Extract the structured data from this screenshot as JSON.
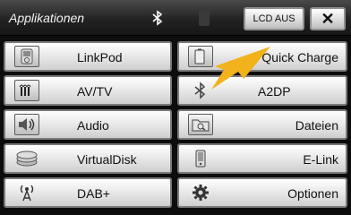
{
  "header": {
    "title": "Applikationen",
    "lcd_button": "LCD AUS",
    "close_button": "✕"
  },
  "tiles": {
    "left": [
      {
        "label": "LinkPod",
        "icon": "ipod-icon"
      },
      {
        "label": "AV/TV",
        "icon": "av-tv-icon"
      },
      {
        "label": "Audio",
        "icon": "speaker-icon"
      },
      {
        "label": "VirtualDisk",
        "icon": "disc-icon"
      },
      {
        "label": "DAB+",
        "icon": "antenna-icon"
      }
    ],
    "right": [
      {
        "label": "Quick Charge",
        "icon": "phone-charge-icon"
      },
      {
        "label": "A2DP",
        "icon": "bluetooth-icon"
      },
      {
        "label": "Dateien",
        "icon": "folder-search-icon"
      },
      {
        "label": "E-Link",
        "icon": "phone-icon"
      },
      {
        "label": "Optionen",
        "icon": "gear-icon"
      }
    ]
  },
  "colors": {
    "highlight_arrow": "#f2b21b"
  }
}
